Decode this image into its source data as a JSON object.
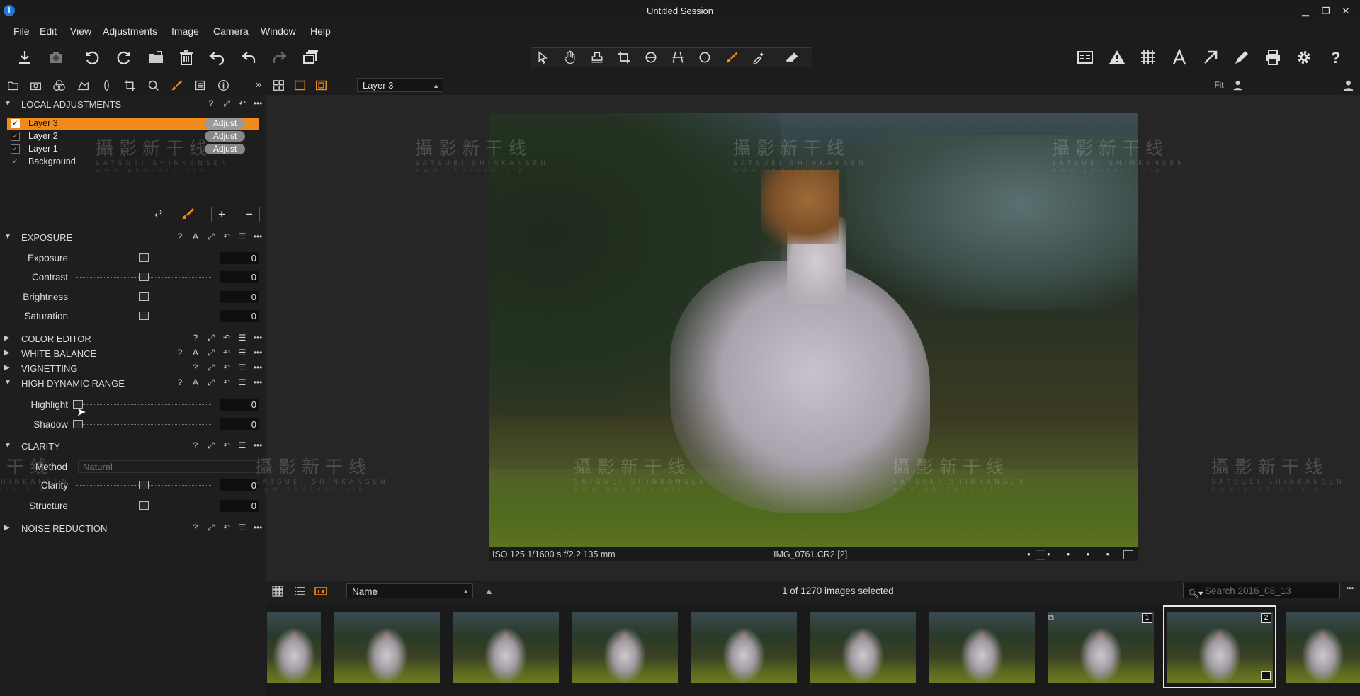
{
  "window": {
    "title": "Untitled Session",
    "app_icon": "i",
    "minimize": "▁",
    "maximize": "❐",
    "close": "✕"
  },
  "menu": [
    "File",
    "Edit",
    "View",
    "Adjustments",
    "Image",
    "Camera",
    "Window",
    "Help"
  ],
  "toolbar": {
    "left_icons": [
      "import-icon",
      "camera-icon",
      "rotate-left-icon",
      "rotate-right-icon",
      "move-to-folder-icon",
      "trash-icon",
      "undo-alt-icon",
      "undo-icon",
      "redo-icon",
      "copy-stack-icon"
    ],
    "cursor_tools": [
      "pointer-icon",
      "hand-pan-icon",
      "stamp-icon",
      "crop-icon",
      "rotate-straighten-icon",
      "keystone-icon",
      "circle-spot-icon",
      "brush-icon",
      "color-picker-icon",
      "eraser-icon"
    ],
    "right_icons": [
      "before-after-icon",
      "warning-icon",
      "grid-icon",
      "text-annotation-icon",
      "export-arrow-icon",
      "edit-icon",
      "print-icon",
      "settings-icon",
      "help-icon"
    ]
  },
  "tool_tabs": {
    "icons": [
      "library-icon",
      "capture-icon",
      "color-icon",
      "lens-icon",
      "exposure-icon",
      "crop-tab-icon",
      "details-icon",
      "local-adjust-icon",
      "metadata-icon",
      "info-icon"
    ],
    "more": "»",
    "layer_select": "Layer 3",
    "fit_label": "Fit"
  },
  "local_adjustments": {
    "title": "LOCAL ADJUSTMENTS",
    "layers": [
      {
        "name": "Layer 3",
        "button": "Adjust",
        "selected": true
      },
      {
        "name": "Layer 2",
        "button": "Adjust",
        "selected": false
      },
      {
        "name": "Layer 1",
        "button": "Adjust",
        "selected": false
      },
      {
        "name": "Background",
        "button": "",
        "selected": false
      }
    ],
    "add": "+",
    "remove": "−"
  },
  "exposure": {
    "title": "EXPOSURE",
    "rows": [
      {
        "label": "Exposure",
        "value": "0",
        "pos": 0.5
      },
      {
        "label": "Contrast",
        "value": "0",
        "pos": 0.5
      },
      {
        "label": "Brightness",
        "value": "0",
        "pos": 0.5
      },
      {
        "label": "Saturation",
        "value": "0",
        "pos": 0.5
      }
    ]
  },
  "sections": {
    "color_editor": "COLOR EDITOR",
    "white_balance": "WHITE BALANCE",
    "vignetting": "VIGNETTING",
    "hdr": "HIGH DYNAMIC RANGE",
    "clarity": "CLARITY",
    "noise": "NOISE REDUCTION"
  },
  "hdr": {
    "rows": [
      {
        "label": "Highlight",
        "value": "0",
        "pos": 0
      },
      {
        "label": "Shadow",
        "value": "0",
        "pos": 0
      }
    ]
  },
  "clarity": {
    "method_label": "Method",
    "method_value": "Natural",
    "rows": [
      {
        "label": "Clarity",
        "value": "0",
        "pos": 0.5
      },
      {
        "label": "Structure",
        "value": "0",
        "pos": 0.5
      }
    ]
  },
  "viewer": {
    "info_left": "ISO 125  1/1600 s  f/2.2  135 mm",
    "info_center": "IMG_0761.CR2 [2]",
    "dots": "• • • • •"
  },
  "watermark": {
    "big": "攝影新干线",
    "small": "SATSUEI SHINKANSEN",
    "url": "www.photoss.vip"
  },
  "browser": {
    "sort": "Name",
    "count": "1 of 1270 images selected",
    "search_placeholder": "Search 2016_08_13",
    "more": "•••",
    "thumb_badges": {
      "first": "1",
      "second": "2"
    }
  },
  "colors": {
    "accent": "#f08a1c",
    "panel": "#1e1e1e",
    "viewer": "#262626"
  }
}
